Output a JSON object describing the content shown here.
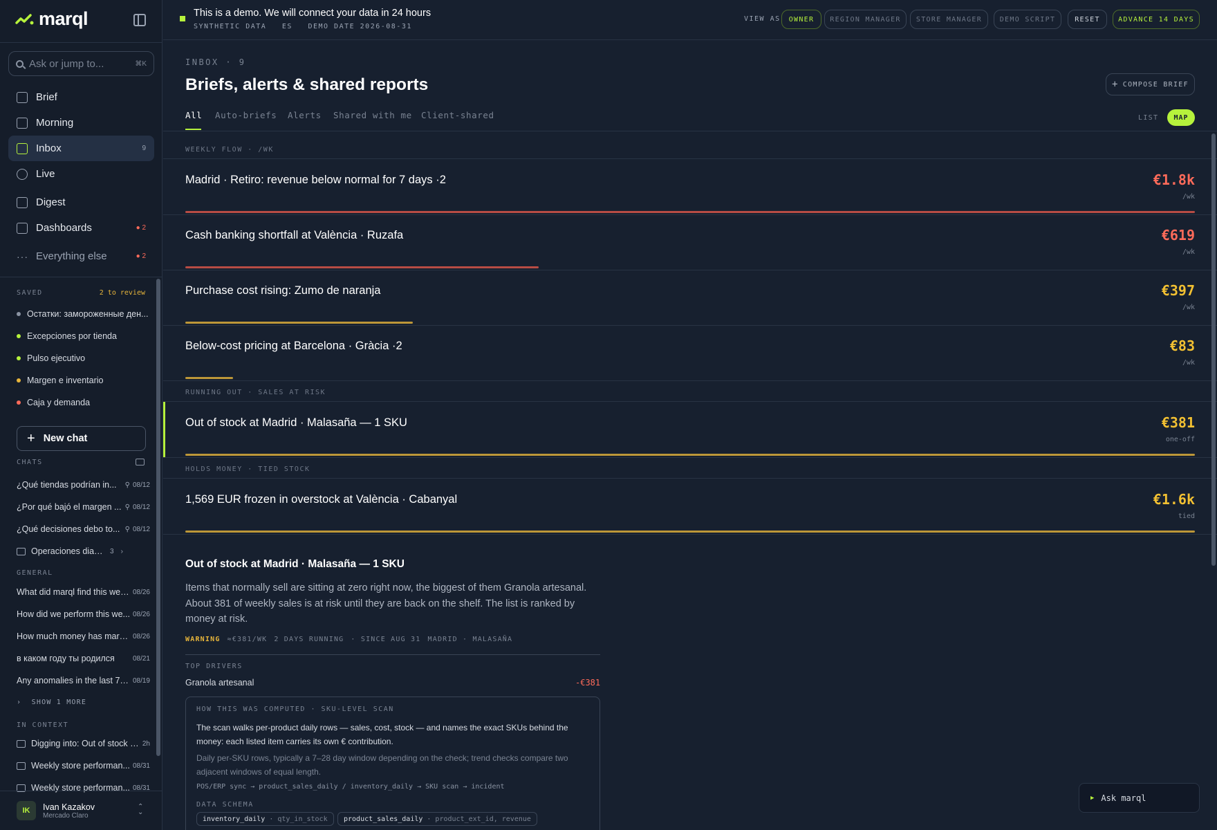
{
  "app": {
    "name": "marql"
  },
  "colors": {
    "accent": "#b6f23c",
    "red": "#e0574a",
    "amber": "#e7b53b",
    "redText": "#ff6b5a",
    "amberText": "#f2c032"
  },
  "search": {
    "placeholder": "Ask or jump to...",
    "shortcut": "⌘K"
  },
  "nav": [
    {
      "label": "Brief",
      "icon": "document-icon"
    },
    {
      "label": "Morning",
      "icon": "sunrise-icon"
    },
    {
      "label": "Inbox",
      "icon": "inbox-icon",
      "count": "9"
    },
    {
      "label": "Live",
      "icon": "gauge-icon"
    },
    {
      "label": "Digest",
      "icon": "table-icon"
    },
    {
      "label": "Dashboards",
      "icon": "grid-icon",
      "badge": "2"
    },
    {
      "label": "Everything else",
      "icon": "more-icon",
      "badge": "2"
    }
  ],
  "saved": {
    "title": "SAVED",
    "review": "2 to review",
    "items": [
      {
        "label": "Остатки: замороженные ден...",
        "color": "#8a93a2"
      },
      {
        "label": "Excepciones por tienda",
        "color": "#b6f23c"
      },
      {
        "label": "Pulso ejecutivo",
        "color": "#b6f23c"
      },
      {
        "label": "Margen e inventario",
        "color": "#e7b53b"
      },
      {
        "label": "Caja y demanda",
        "color": "#ff6b5a"
      }
    ]
  },
  "new_chat": "New chat",
  "chats": {
    "title": "CHATS",
    "items": [
      {
        "title": "¿Qué tiendas podrían in...",
        "date": "08/12"
      },
      {
        "title": "¿Por qué bajó el margen ...",
        "date": "08/12"
      },
      {
        "title": "¿Qué decisiones debo to...",
        "date": "08/12"
      }
    ],
    "folder": {
      "name": "Operaciones diar...",
      "count": "3"
    }
  },
  "general": {
    "title": "GENERAL",
    "items": [
      {
        "title": "What did marql find this wee...",
        "date": "08/26"
      },
      {
        "title": "How did we perform this we...",
        "date": "08/26"
      },
      {
        "title": "How much money has marql ...",
        "date": "08/26"
      },
      {
        "title": "в каком году ты родился",
        "date": "08/21"
      },
      {
        "title": "Any anomalies in the last 7 d...",
        "date": "08/19"
      }
    ],
    "show_more": "SHOW 1 MORE"
  },
  "in_context": {
    "title": "IN CONTEXT",
    "items": [
      {
        "title": "Digging into: Out of stock a...",
        "date": "2h"
      },
      {
        "title": "Weekly store performan...",
        "date": "08/31"
      },
      {
        "title": "Weekly store performan...",
        "date": "08/31"
      }
    ]
  },
  "user": {
    "initials": "IK",
    "name": "Ivan Kazakov",
    "org": "Mercado Claro"
  },
  "topbar": {
    "demo_title": "This is a demo. We will connect your data in 24 hours",
    "demo_sub": "SYNTHETIC DATA   ES   DEMO DATE 2026-08-31",
    "view_as": "VIEW AS",
    "roles": [
      "OWNER",
      "REGION MANAGER",
      "STORE MANAGER",
      "DEMO SCRIPT"
    ],
    "reset": "RESET",
    "advance": "ADVANCE 14 DAYS"
  },
  "page": {
    "crumb": "INBOX · 9",
    "title": "Briefs, alerts & shared reports",
    "compose": "COMPOSE BRIEF",
    "tabs": [
      "All",
      "Auto-briefs",
      "Alerts",
      "Shared with me",
      "Client-shared"
    ],
    "view": {
      "list": "LIST",
      "map": "MAP"
    }
  },
  "groups": [
    {
      "label": "WEEKLY FLOW · /WK",
      "rows": [
        {
          "title": "Madrid · Retiro: revenue below normal for 7 days ·2",
          "value": "€1.8k",
          "unit": "/wk",
          "level": "red",
          "fraction": 1.0
        },
        {
          "title": "Cash banking shortfall at València · Ruzafa",
          "value": "€619",
          "unit": "/wk",
          "level": "red",
          "fraction": 0.35
        },
        {
          "title": "Purchase cost rising: Zumo de naranja",
          "value": "€397",
          "unit": "/wk",
          "level": "amber",
          "fraction": 0.225
        },
        {
          "title": "Below-cost pricing at Barcelona · Gràcia ·2",
          "value": "€83",
          "unit": "/wk",
          "level": "amber",
          "fraction": 0.047
        }
      ]
    },
    {
      "label": "RUNNING OUT · SALES AT RISK",
      "rows": [
        {
          "title": "Out of stock at Madrid · Malasaña — 1 SKU",
          "value": "€381",
          "unit": "one-off",
          "level": "amber",
          "fraction": 1.0,
          "selected": true
        }
      ]
    },
    {
      "label": "HOLDS MONEY · TIED STOCK",
      "rows": [
        {
          "title": "1,569 EUR frozen in overstock at València · Cabanyal",
          "value": "€1.6k",
          "unit": "tied",
          "level": "amber",
          "fraction": 1.0
        }
      ]
    }
  ],
  "detail": {
    "title": "Out of stock at Madrid · Malasaña — 1 SKU",
    "body": "Items that normally sell are sitting at zero right now, the biggest of them Granola artesanal. About 381 of weekly sales is at risk until they are back on the shelf. The list is ranked by money at risk.",
    "meta": {
      "severity": "WARNING",
      "value": "≈€381/WK",
      "running": "2 DAYS RUNNING",
      "since": "· SINCE AUG 31",
      "location": "MADRID · MALASAÑA"
    },
    "drivers_title": "TOP DRIVERS",
    "drivers": [
      {
        "name": "Granola artesanal",
        "value": "-€381"
      }
    ],
    "how": {
      "title": "HOW THIS WAS COMPUTED · SKU-LEVEL SCAN",
      "p1": "The scan walks per-product daily rows — sales, cost, stock — and names the exact SKUs behind the money: each listed item carries its own € contribution.",
      "p2": "Daily per-SKU rows, typically a 7–28 day window depending on the check; trend checks compare two adjacent windows of equal length.",
      "flow": "POS/ERP sync → product_sales_daily / inventory_daily → SKU scan → incident",
      "schema_title": "DATA SCHEMA",
      "schema": [
        {
          "table": "inventory_daily",
          "cols": "· qty_in_stock"
        },
        {
          "table": "product_sales_daily",
          "cols": "· product_ext_id, revenue"
        }
      ]
    }
  },
  "ask": "Ask marql"
}
